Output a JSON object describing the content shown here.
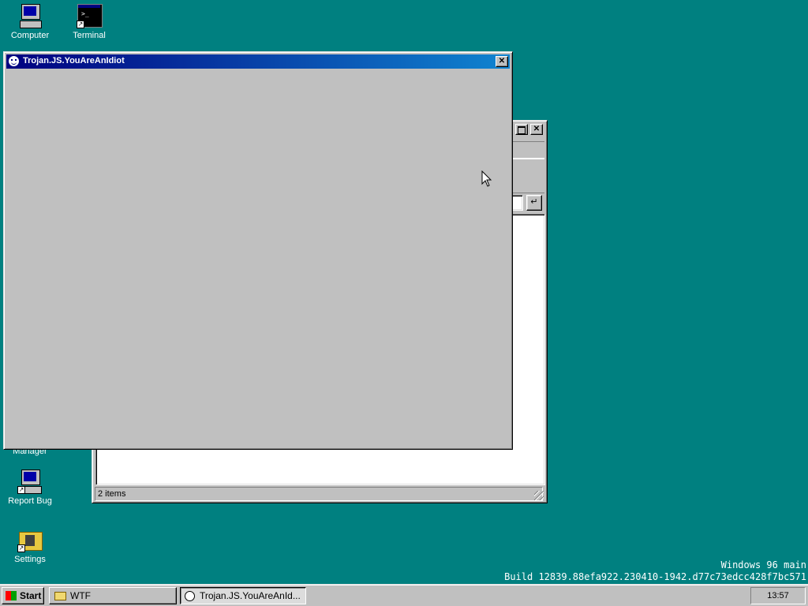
{
  "desktop": {
    "icons": [
      {
        "label": "Computer",
        "icon": "computer-icon"
      },
      {
        "label": "Terminal",
        "icon": "terminal-icon"
      },
      {
        "label": "Manager",
        "icon": "manager-icon"
      },
      {
        "label": "Report Bug",
        "icon": "report-bug-icon"
      },
      {
        "label": "Settings",
        "icon": "settings-icon"
      }
    ],
    "watermark_line1": "Windows 96 main",
    "watermark_line2": "Build 12839.88efa922.230410-1942.d77c73edcc428f7bc571"
  },
  "explorer_window": {
    "status_text": "2 items",
    "go_glyph": "↵"
  },
  "trojan_window": {
    "title": "Trojan.JS.YouAreAnIdiot",
    "close_glyph": "✕"
  },
  "taskbar": {
    "start_label": "Start",
    "tasks": [
      {
        "label": "WTF",
        "icon": "folder-icon"
      },
      {
        "label": "Trojan.JS.YouAreAnId...",
        "icon": "smiley-icon"
      }
    ],
    "clock": "13:57"
  },
  "colors": {
    "desktop": "#008080",
    "title_active_start": "#000080",
    "title_active_end": "#1084d0",
    "face": "#c0c0c0"
  }
}
